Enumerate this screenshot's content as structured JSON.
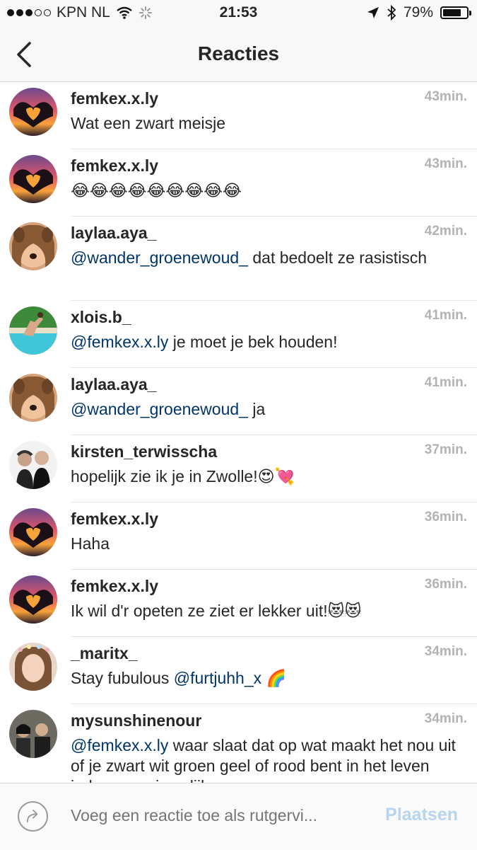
{
  "status_bar": {
    "carrier": "KPN NL",
    "time": "21:53",
    "battery": "79%",
    "battery_level": 0.79
  },
  "nav": {
    "title": "Reacties"
  },
  "comments": [
    {
      "user": "femkex.x.ly",
      "time": "43min.",
      "mention": "",
      "text": "Wat een zwart meisje",
      "emoji": "",
      "avatar": "heart-hands"
    },
    {
      "user": "femkex.x.ly",
      "time": "43min.",
      "mention": "",
      "text": "",
      "emoji": "😂😂😂😂😂😂😂😂😂",
      "avatar": "heart-hands"
    },
    {
      "user": "laylaa.aya_",
      "time": "42min.",
      "mention": "@wander_groenewoud_",
      "text": " dat bedoelt ze rasistisch",
      "emoji": "",
      "avatar": "girl-dog-filter"
    },
    {
      "user": "xlois.b_",
      "time": "41min.",
      "mention": "@femkex.x.ly",
      "text": " je moet je bek houden!",
      "emoji": "",
      "avatar": "pool-jump"
    },
    {
      "user": "laylaa.aya_",
      "time": "41min.",
      "mention": "@wander_groenewoud_",
      "text": " ja",
      "emoji": "",
      "avatar": "girl-dog-filter"
    },
    {
      "user": "kirsten_terwisscha",
      "time": "37min.",
      "mention": "",
      "text": "hopelijk zie ik je in Zwolle!",
      "emoji": "😍💘",
      "avatar": "two-people"
    },
    {
      "user": "femkex.x.ly",
      "time": "36min.",
      "mention": "",
      "text": "Haha",
      "emoji": "",
      "avatar": "heart-hands"
    },
    {
      "user": "femkex.x.ly",
      "time": "36min.",
      "mention": "",
      "text": "Ik wil d'r opeten ze ziet er lekker uit!",
      "emoji": "😻😻",
      "avatar": "heart-hands"
    },
    {
      "user": "_maritx_",
      "time": "34min.",
      "text": "Stay fubulous ",
      "mention_after": "@furtjuhh_x",
      "emoji": "🌈",
      "avatar": "girl-portrait"
    },
    {
      "user": "mysunshinenour",
      "time": "34min.",
      "mention": "@femkex.x.ly",
      "text": " waar slaat dat op wat maakt het nou uit of je zwart wit groen geel of rood bent in het leven ieder mens is gelijk",
      "emoji": "",
      "avatar": "group-people"
    }
  ],
  "compose": {
    "placeholder": "Voeg een reactie toe als rutgervi...",
    "post_label": "Plaatsen"
  },
  "colors": {
    "mention": "#003569",
    "timestamp": "#b3b3b3",
    "post_disabled": "#b8d4ef"
  }
}
